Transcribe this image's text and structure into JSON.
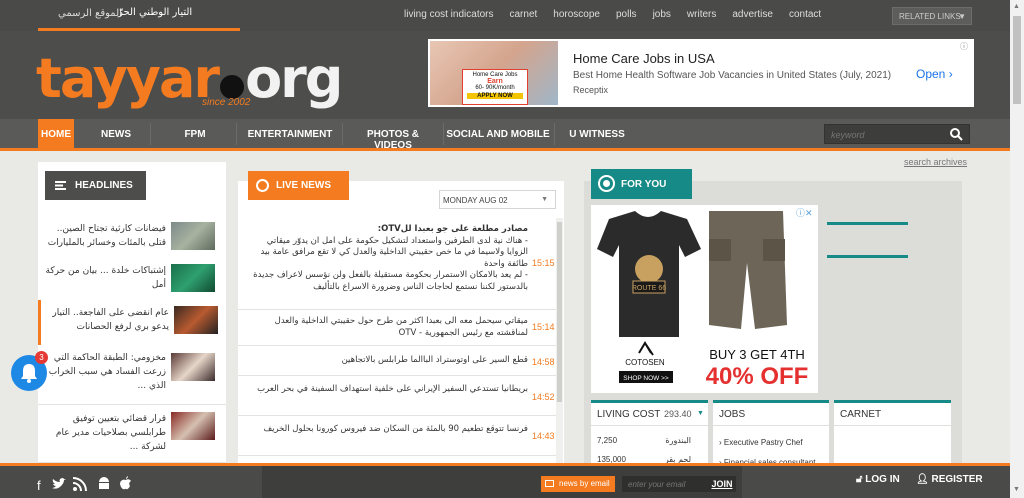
{
  "topbar": {
    "tayyar_name": "التيار الوطني الحرّ",
    "official_site": "الموقع الرسمي",
    "links": [
      "living cost indicators",
      "carnet",
      "horoscope",
      "polls",
      "jobs",
      "writers",
      "advertise",
      "contact"
    ],
    "related_links": "RELATED LINKS"
  },
  "logo": {
    "text_a": "tayyar",
    "text_b": "org",
    "since": "since 2002"
  },
  "ad_top": {
    "card_title": "Home Care Jobs",
    "card_earn": "Earn",
    "card_range": "60- 90K/month",
    "card_cta": "APPLY NOW",
    "title": "Home Care Jobs in USA",
    "subtitle": "Best Home Health Software Job Vacancies in United States (July, 2021)",
    "brand": "Receptix",
    "open": "Open"
  },
  "nav": {
    "items": [
      "HOME",
      "NEWS",
      "FPM",
      "ENTERTAINMENT",
      "PHOTOS & VIDEOS",
      "SOCIAL AND MOBILE",
      "U WITNESS"
    ],
    "search_placeholder": "keyword",
    "search_archives": "search archives"
  },
  "headlines": {
    "title": "HEADLINES",
    "items": [
      {
        "text": "فيضانات كارثية تجتاح الصين.. قتلى بالمئات وخسائر بالمليارات"
      },
      {
        "text": "إشتباكات خلدة ... بيان من حركة أمل"
      },
      {
        "text": "عام انقضى على الفاجعة.. التيار يدعو بري لرفع الحصانات"
      },
      {
        "text": "مخزومي: الطبقة الحاكمة التي زرعت الفساد هي سبب الخراب الذي ..."
      },
      {
        "text": "قرار قضائي بتعيين توفيق طرابلسي بصلاحيات مدير عام لشركة ..."
      }
    ]
  },
  "live_news": {
    "title": "LIVE NEWS",
    "date": "MONDAY AUG 02",
    "items": [
      {
        "time": "15:15",
        "lines": [
          "مصادر مطلعة على جو بعبدا للOTV:",
          "- هناك نية لدى الطرفين واستعداد لتشكيل حكومة على امل ان يدوّر ميقاتي الزوايا ولاسيما في ما خص حقيبتي الداخلية والعدل كي لا تقع مرافق عامة بيد طائفة واحدة",
          "- لم يعد بالامكان الاستمرار بحكومة مستقيلة بالفعل ولن نؤسس لاعراف جديدة بالدستور لكننا نستمع لحاجات الناس وضرورة الاسراع بالتأليف"
        ]
      },
      {
        "time": "15:14",
        "lines": [
          "ميقاتي سيحمل معه الى بعبدا اكثر من طرح حول حقيبتي الداخلية والعدل لمناقشته مع رئيس الجمهورية - OTV"
        ]
      },
      {
        "time": "14:58",
        "lines": [
          "قطع السير على اوتوستراد الباالما طرابلس بالاتجاهين"
        ]
      },
      {
        "time": "14:52",
        "lines": [
          "بريطانيا تستدعي السفير الإيراني على خلفية استهداف السفينة في بحر العرب"
        ]
      },
      {
        "time": "14:43",
        "lines": [
          "فرنسا تتوقع تطعيم 90 بالمئة من السكان ضد فيروس كورونا بحلول الخريف"
        ]
      }
    ]
  },
  "for_you": {
    "title": "FOR YOU",
    "ad_brand": "COTOSEN",
    "ad_shop": "SHOP NOW >>",
    "ad_offer": "BUY 3 GET 4TH",
    "ad_discount": "40% OFF",
    "shirt_badge": "ROUTE 66"
  },
  "living_cost": {
    "title": "LIVING COST",
    "value": "293.40",
    "rows": [
      {
        "price": "7,250",
        "item": "البندورة"
      },
      {
        "price": "135,000",
        "item": "لحم بقر"
      }
    ]
  },
  "jobs": {
    "title": "JOBS",
    "items": [
      "Executive Pastry Chef",
      "Financial sales consultant"
    ]
  },
  "carnet": {
    "title": "CARNET"
  },
  "footer": {
    "news_by_email": "news by email",
    "email_placeholder": "enter your email",
    "join": "JOIN",
    "login": "LOG IN",
    "register": "REGISTER"
  },
  "notification": {
    "count": "3"
  },
  "colors": {
    "accent": "#f47b20",
    "teal": "#168a86",
    "dark": "#4a4a48"
  }
}
